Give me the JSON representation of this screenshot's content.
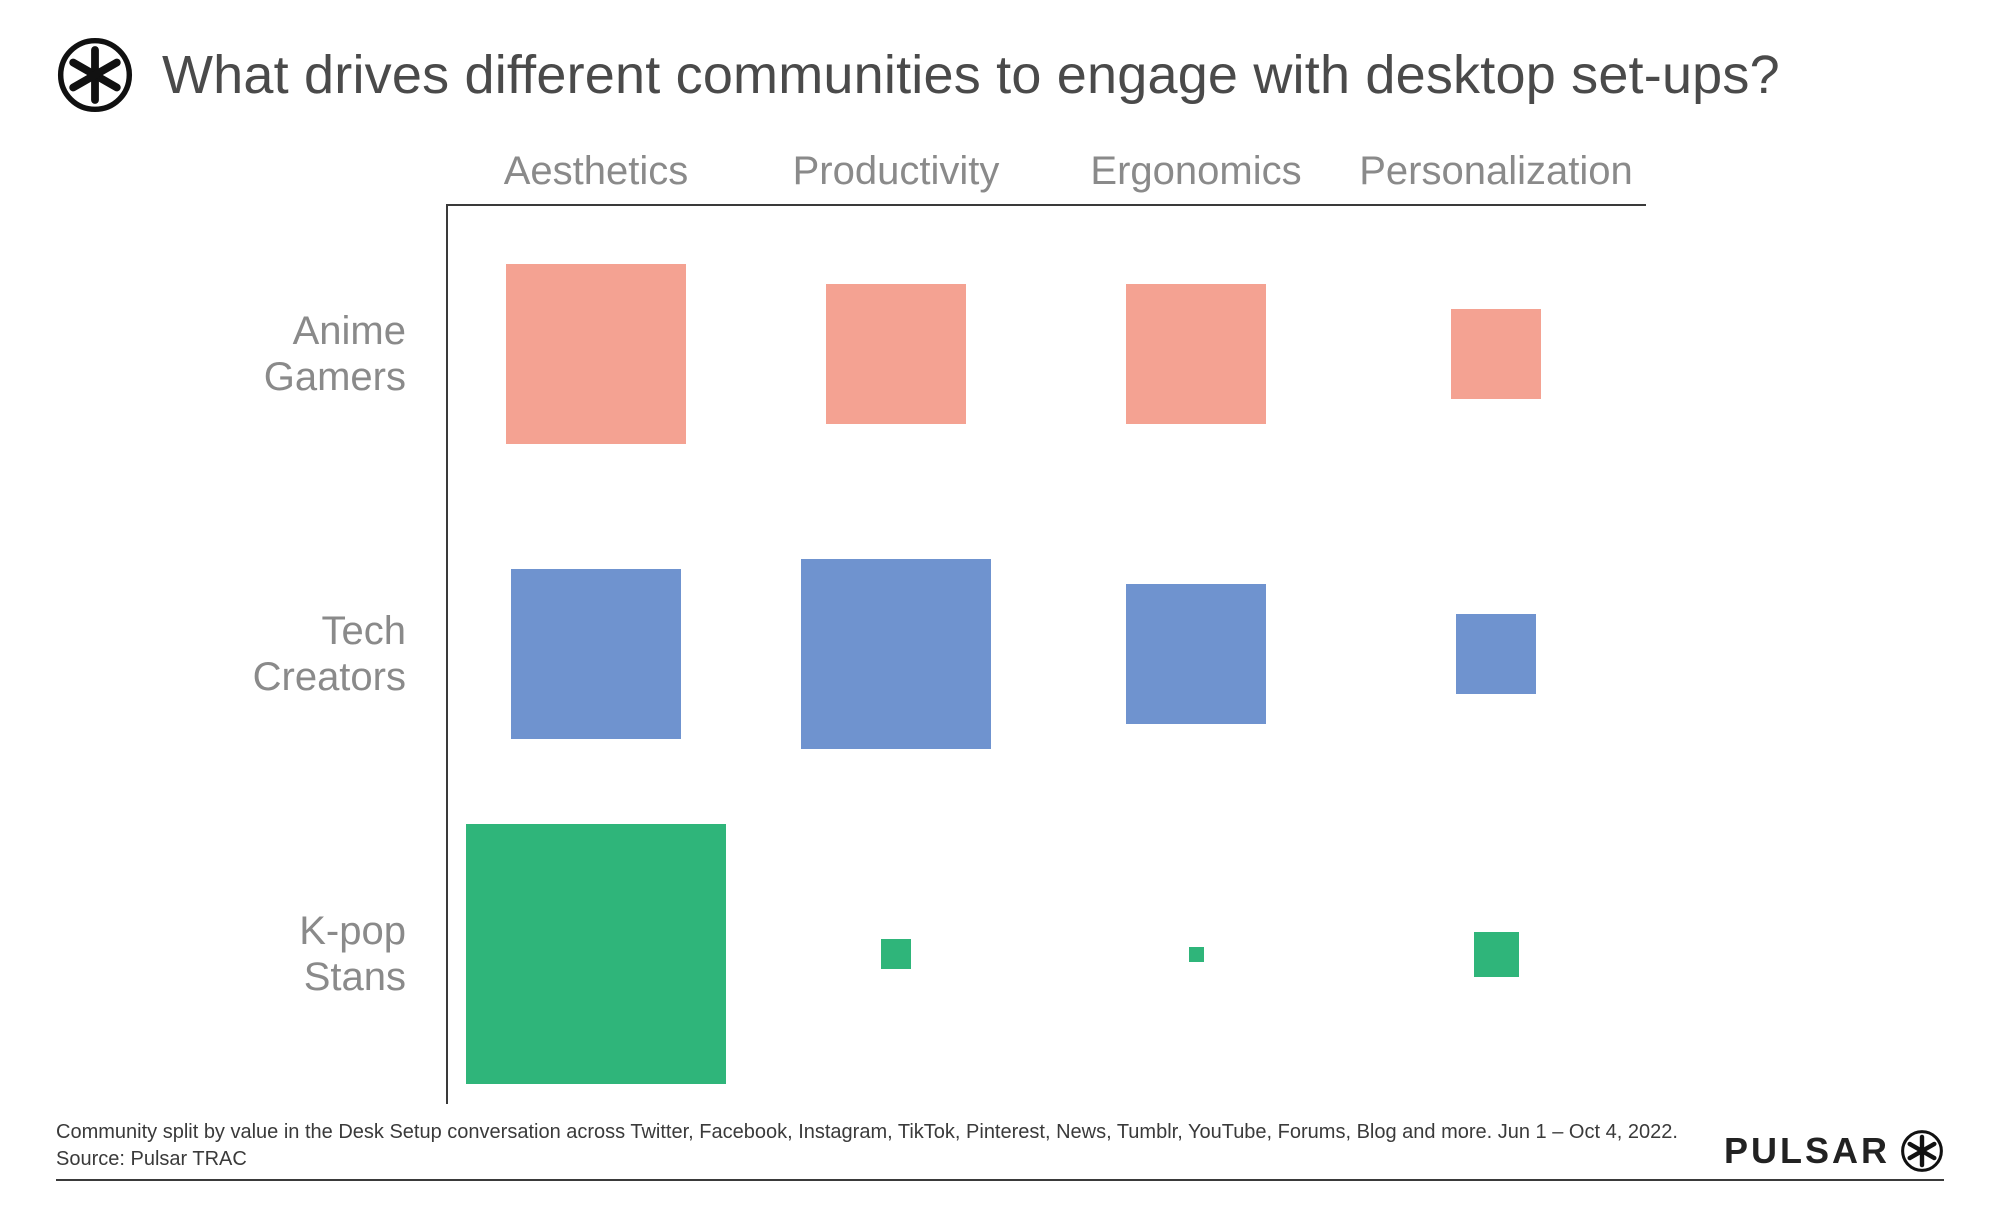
{
  "title": "What drives different communities to engage with desktop set-ups?",
  "footer_line1": "Community split by value in the Desk Setup conversation across Twitter, Facebook, Instagram, TikTok, Pinterest, News, Tumblr, YouTube, Forums, Blog and more.  Jun 1 – Oct 4, 2022.",
  "footer_line2": "Source: Pulsar TRAC",
  "brand": "PULSAR",
  "chart_data": {
    "type": "heatmap",
    "title": "What drives different communities to engage with desktop set-ups?",
    "xlabel": "",
    "ylabel": "",
    "encoding": "square side length ∝ value (relative within-row emphasis; no numeric axis shown)",
    "categories": [
      "Aesthetics",
      "Productivity",
      "Ergonomics",
      "Personalization"
    ],
    "series": [
      {
        "name": "Anime\nGamers",
        "color": "#f4a292",
        "values": [
          180,
          140,
          140,
          90
        ]
      },
      {
        "name": "Tech\nCreators",
        "color": "#6f93cf",
        "values": [
          170,
          190,
          140,
          80
        ]
      },
      {
        "name": "K-pop\nStans",
        "color": "#2fb57a",
        "values": [
          260,
          30,
          15,
          45
        ]
      }
    ]
  }
}
